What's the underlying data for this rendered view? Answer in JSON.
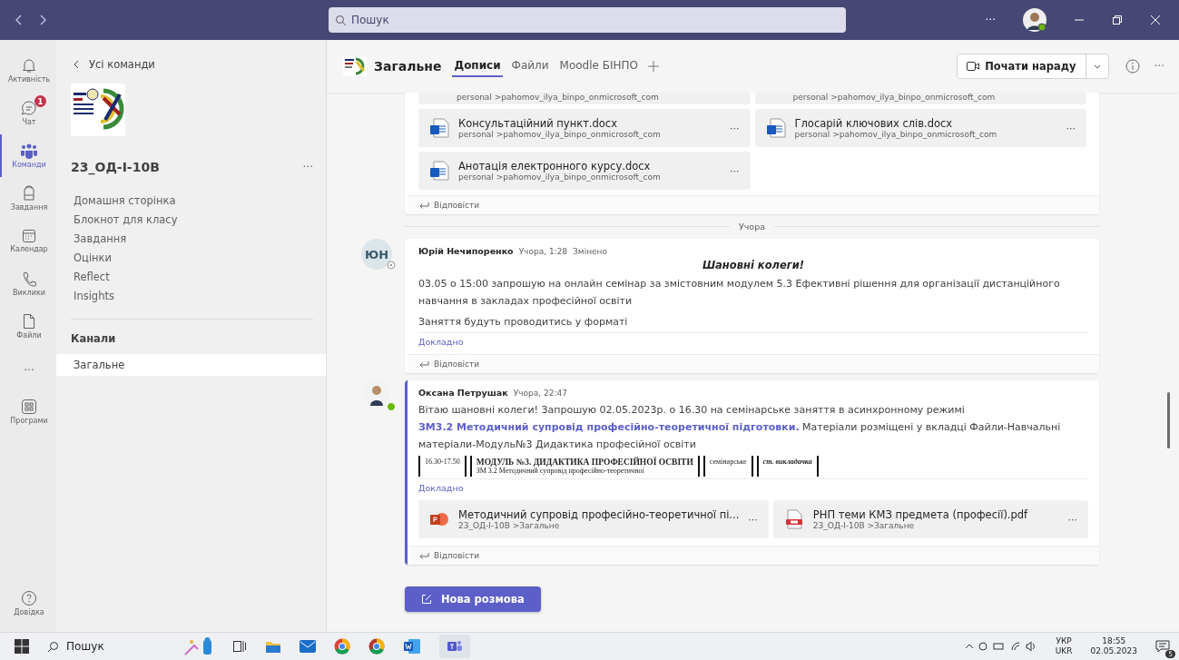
{
  "titlebar": {
    "search_placeholder": "Пошук",
    "more": "···"
  },
  "rail": [
    {
      "label": "Активність",
      "selected": false
    },
    {
      "label": "Чат",
      "selected": false,
      "badge": "1"
    },
    {
      "label": "Команди",
      "selected": true
    },
    {
      "label": "Завдання",
      "selected": false
    },
    {
      "label": "Календар",
      "selected": false
    },
    {
      "label": "Виклики",
      "selected": false
    },
    {
      "label": "Файли",
      "selected": false
    },
    {
      "label": "···",
      "selected": false
    },
    {
      "label": "Програми",
      "selected": false
    }
  ],
  "rail_bottom": {
    "label": "Довідка"
  },
  "team_panel": {
    "back": "Усі команди",
    "team_name": "23_ОД-І-10В",
    "more": "···",
    "nav": [
      "Домашня сторінка",
      "Блокнот для класу",
      "Завдання",
      "Оцінки",
      "Reflect",
      "Insights"
    ],
    "channels_heading": "Канали",
    "channels": [
      {
        "name": "Загальне",
        "selected": true
      }
    ]
  },
  "header": {
    "channel": "Загальне",
    "tabs": [
      {
        "label": "Дописи",
        "selected": true
      },
      {
        "label": "Файли",
        "selected": false
      },
      {
        "label": "Moodle БІНПО",
        "selected": false
      }
    ],
    "meet_button": "Почати нараду",
    "more": "···"
  },
  "feed": [
    {
      "kind": "files",
      "files": [
        {
          "path": "personal >pahomov_ilya_binpo_onmicrosoft_com"
        },
        {
          "path": "personal >pahomov_ilya_binpo_onmicrosoft_com"
        },
        {
          "name": "Консультаційний пункт.docx",
          "path": "personal >pahomov_ilya_binpo_onmicrosoft_com",
          "more": "···"
        },
        {
          "name": "Глосарій ключових слів.docx",
          "path": "personal >pahomov_ilya_binpo_onmicrosoft_com",
          "more": "···"
        },
        {
          "name": "Анотація електронного курсу.docx",
          "path": "personal >pahomov_ilya_binpo_onmicrosoft_com",
          "more": "···"
        }
      ],
      "reply": "Відповісти"
    },
    {
      "kind": "divider",
      "label": "Учора"
    },
    {
      "kind": "message",
      "author": "Юрій Нечипоренко",
      "time": "Учора, 1:28",
      "edited": "Змінено",
      "avatar": {
        "initials": "ЮН",
        "available": false
      },
      "accent": false,
      "heading": "Шановні колеги!",
      "paragraphs": [
        "03.05 о 15:00 запрошую на онлайн семінар за змістовним модулем 5.3 Ефективні рішення для організації дистанційного навчання  в закладах професійної освіти",
        "Заняття будуть проводитись у форматі"
      ],
      "more_link": "Докладно",
      "reply": "Відповісти"
    },
    {
      "kind": "message",
      "author": "Оксана Петрушак",
      "time": "Учора, 22:47",
      "avatar": {
        "available": true
      },
      "accent": true,
      "rich_text": {
        "before": "Вітаю шановні колеги! Запрошую 02.05.2023р. о 16.30 на семінарське заняття в асинхронному режимі",
        "link": "ЗМ3.2 Методичний супровід професійно-теоретичної підготовки.",
        "after": "Матеріали розміщені у вкладці Файли-Навчальні матеріали-Модуль№3 Дидактика професійної освіти"
      },
      "preview": [
        "16.30-17.50",
        "МОДУЛЬ №3. ДИДАКТИКА ПРОФЕСІЙНОЇ ОСВІТИ",
        "ЗМ 3.2 Методичний супровід професійно-теоретичної",
        "семінарське",
        "ст. викладачка"
      ],
      "more_link": "Докладно",
      "files": [
        {
          "kind": "ppt",
          "name": "Методичний супровід професійно-теоретичної пі...",
          "path": "23_ОД-І-10В >Загальне",
          "more": "···"
        },
        {
          "kind": "pdf",
          "name": "РНП теми КМЗ предмета (професії).pdf",
          "path": "23_ОД-І-10В >Загальне",
          "more": "···"
        }
      ],
      "reply": "Відповісти"
    }
  ],
  "new_conversation": "Нова розмова",
  "taskbar": {
    "search": "Пошук",
    "lang_top": "УКР",
    "lang_bottom": "UKR",
    "time": "18:55",
    "date": "02.05.2023",
    "notifications": "5"
  }
}
